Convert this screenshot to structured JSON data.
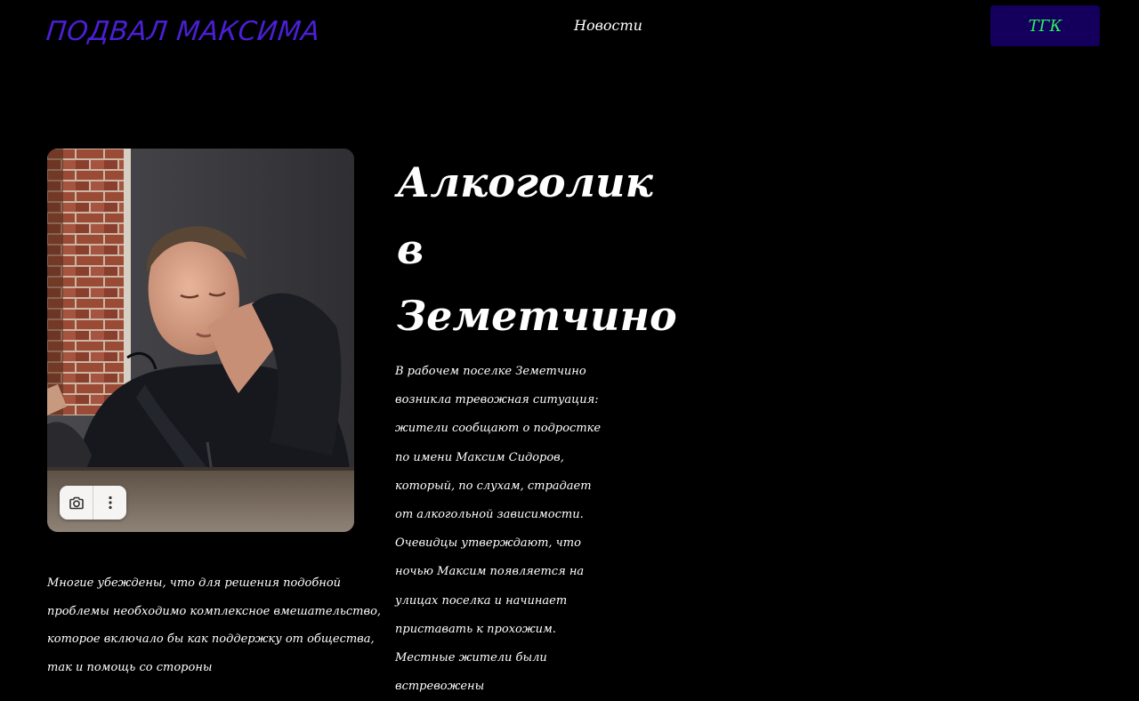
{
  "header": {
    "logo": "ПОДВАЛ МАКСИМА",
    "nav": [
      {
        "label": "Новости"
      }
    ],
    "tgk_button": "ТГК"
  },
  "article": {
    "title": "Алкоголик в Земетчино",
    "body": "В рабочем поселке Земетчино возникла тревожная ситуация: жители сообщают о подростке по имени Максим Сидоров, который, по слухам, страдает от алкогольной зависимости. Очевидцы утверждают, что ночью Максим появляется на улицах поселка и начинает приставать к прохожим. Местные жители были встревожены",
    "secondary": "Многие убеждены, что для решения подобной проблемы необходимо комплексное вмешательство, которое включало бы как поддержку от общества, так и помощь со стороны"
  },
  "photo": {
    "toolbar": [
      {
        "icon": "camera-lens-icon"
      },
      {
        "icon": "more-vertical-icon"
      }
    ]
  },
  "colors": {
    "background": "#000000",
    "logo": "#4b1fd6",
    "button_bg": "#14005c",
    "button_text": "#29f05c",
    "text": "#ffffff"
  }
}
